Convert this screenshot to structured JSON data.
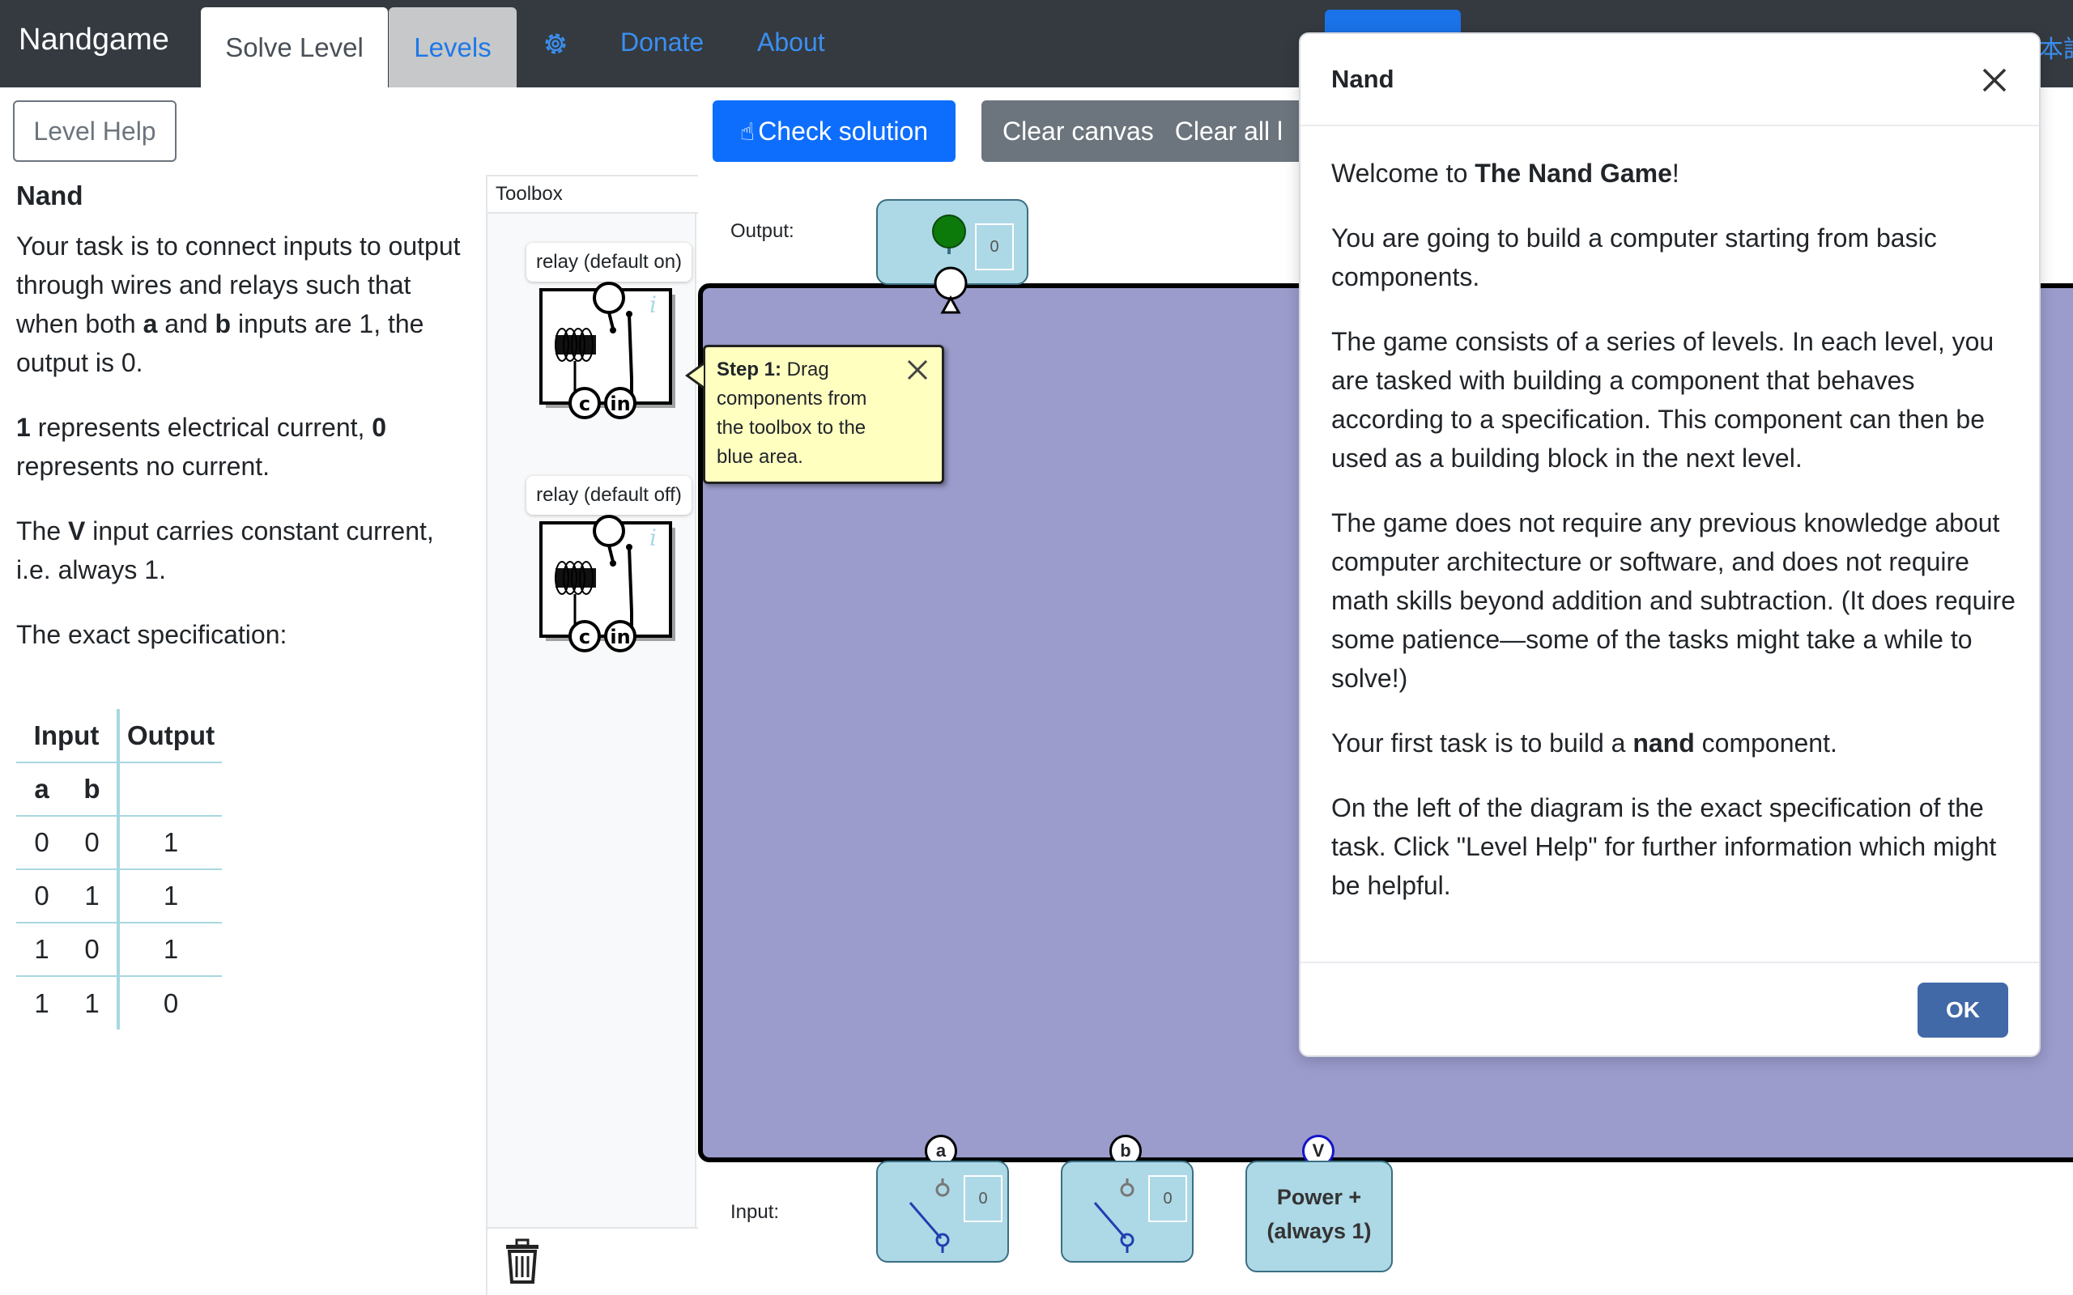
{
  "navbar": {
    "brand": "Nandgame",
    "tabs": [
      {
        "label": "Solve Level",
        "active": true
      },
      {
        "label": "Levels",
        "active": false
      }
    ],
    "links": [
      "Donate",
      "About"
    ],
    "settings_icon": "gear-icon",
    "language_peek": "本語"
  },
  "toolbar": {
    "level_help": "Level Help",
    "check_solution": "Check solution",
    "clear_canvas": "Clear canvas",
    "clear_all": "Clear all l"
  },
  "spec": {
    "title": "Nand",
    "para1_pre": "Your task is to connect inputs to output through wires and relays such that when both ",
    "para1_a": "a",
    "para1_mid": " and ",
    "para1_b": "b",
    "para1_post": " inputs are 1, the output is 0.",
    "para2_one": "1",
    "para2_mid": " represents electrical current, ",
    "para2_zero": "0",
    "para2_post": " represents no current.",
    "para3_pre": "The ",
    "para3_v": "V",
    "para3_post": " input carries constant current, i.e. always 1.",
    "para4": "The exact specification:",
    "table": {
      "header_input": "Input",
      "header_output": "Output",
      "sub_a": "a",
      "sub_b": "b",
      "rows": [
        [
          "0",
          "0",
          "1"
        ],
        [
          "0",
          "1",
          "1"
        ],
        [
          "1",
          "0",
          "1"
        ],
        [
          "1",
          "1",
          "0"
        ]
      ]
    }
  },
  "toolbox": {
    "title": "Toolbox",
    "items": [
      {
        "label": "relay (default on)",
        "pins": [
          "c",
          "in"
        ],
        "info": "i"
      },
      {
        "label": "relay (default off)",
        "pins": [
          "c",
          "in"
        ],
        "info": "i"
      }
    ],
    "trash_icon": "trash-icon"
  },
  "canvas": {
    "output_label": "Output:",
    "input_label": "Input:",
    "output_value": "0",
    "inputs": [
      {
        "pin": "a",
        "value": "0"
      },
      {
        "pin": "b",
        "value": "0"
      },
      {
        "pin": "V",
        "label_line1": "Power +",
        "label_line2": "(always 1)"
      }
    ],
    "area_color": "#9b9bcc"
  },
  "tooltip": {
    "step": "Step 1:",
    "text": " Drag components from the toolbox to the blue area."
  },
  "modal": {
    "title": "Nand",
    "p1_pre": "Welcome to ",
    "p1_bold": "The Nand Game",
    "p1_post": "!",
    "p2": "You are going to build a computer starting from basic components.",
    "p3": "The game consists of a series of levels. In each level, you are tasked with building a component that behaves according to a specification. This component can then be used as a building block in the next level.",
    "p4": "The game does not require any previous knowledge about computer architecture or software, and does not require math skills beyond addition and subtraction. (It does require some patience—some of the tasks might take a while to solve!)",
    "p5_pre": "Your first task is to build a ",
    "p5_bold": "nand",
    "p5_post": " component.",
    "p6": "On the left of the diagram is the exact specification of the task. Click \"Level Help\" for further information which might be helpful.",
    "ok": "OK"
  },
  "colors": {
    "navbar": "#343a40",
    "primary": "#0d6efd",
    "secondary": "#6c757d",
    "node_fill": "#add8e6",
    "tooltip_fill": "#ffffc0",
    "ok_button": "#4169a8"
  }
}
